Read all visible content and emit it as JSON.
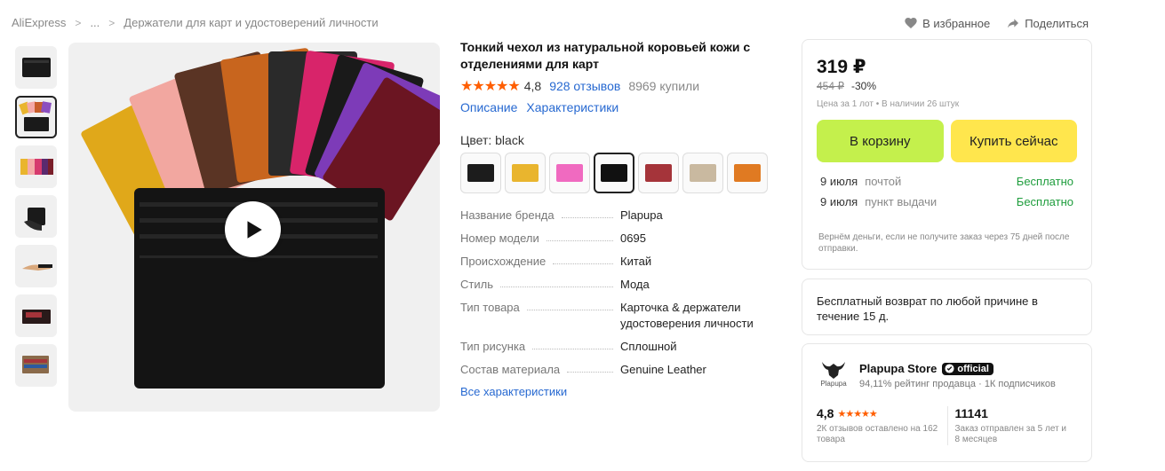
{
  "breadcrumb": {
    "items": [
      "AliExpress",
      "...",
      "Держатели для карт и удостоверений личности"
    ]
  },
  "top_actions": {
    "favorite": "В избранное",
    "share": "Поделиться"
  },
  "product": {
    "title": "Тонкий чехол из натуральной коровьей кожи с отделениями для карт",
    "stars": "★★★★★",
    "rating": "4,8",
    "reviews": "928 отзывов",
    "sold": "8969 купили",
    "tab_description": "Описание",
    "tab_specs": "Характеристики",
    "color_label": "Цвет: black"
  },
  "swatches": [
    {
      "name": "black",
      "color": "#1c1c1c"
    },
    {
      "name": "yellow",
      "color": "#e9b52e"
    },
    {
      "name": "pink",
      "color": "#f06ac0"
    },
    {
      "name": "black",
      "color": "#111111"
    },
    {
      "name": "red",
      "color": "#a5343a"
    },
    {
      "name": "beige",
      "color": "#c9b9a0"
    },
    {
      "name": "orange",
      "color": "#e07a22"
    }
  ],
  "specs": {
    "rows": [
      {
        "k": "Название бренда",
        "v": "Plapupa"
      },
      {
        "k": "Номер модели",
        "v": "0695"
      },
      {
        "k": "Происхождение",
        "v": "Китай"
      },
      {
        "k": "Стиль",
        "v": "Мода"
      },
      {
        "k": "Тип товара",
        "v": "Карточка & держатели удостоверения личности"
      },
      {
        "k": "Тип рисунка",
        "v": "Сплошной"
      },
      {
        "k": "Состав материала",
        "v": "Genuine Leather"
      }
    ],
    "all_link": "Все характеристики"
  },
  "buy": {
    "price": "319 ₽",
    "old_price": "454 ₽",
    "discount": "-30%",
    "lot_info": "Цена за 1 лот • В наличии 26 штук",
    "cart_btn": "В корзину",
    "buy_btn": "Купить сейчас",
    "delivery": [
      {
        "date": "9 июля",
        "method": "почтой",
        "price": "Бесплатно"
      },
      {
        "date": "9 июля",
        "method": "пункт выдачи",
        "price": "Бесплатно"
      }
    ],
    "refund_note": "Вернём деньги, если не получите заказ через 75 дней после отправки."
  },
  "return_policy": "Бесплатный возврат по любой причине в течение 15 д.",
  "store": {
    "logo_text": "Plapupa",
    "name": "Plapupa Store",
    "badge": "official",
    "rating_line": "94,11% рейтинг продавца",
    "subscribers": "1К подписчиков",
    "score": "4,8",
    "score_stars": "★★★★★",
    "score_note": "2К отзывов оставлено на 162 товара",
    "orders": "11141",
    "orders_note": "Заказ отправлен за 5 лет и 8 месяцев"
  }
}
